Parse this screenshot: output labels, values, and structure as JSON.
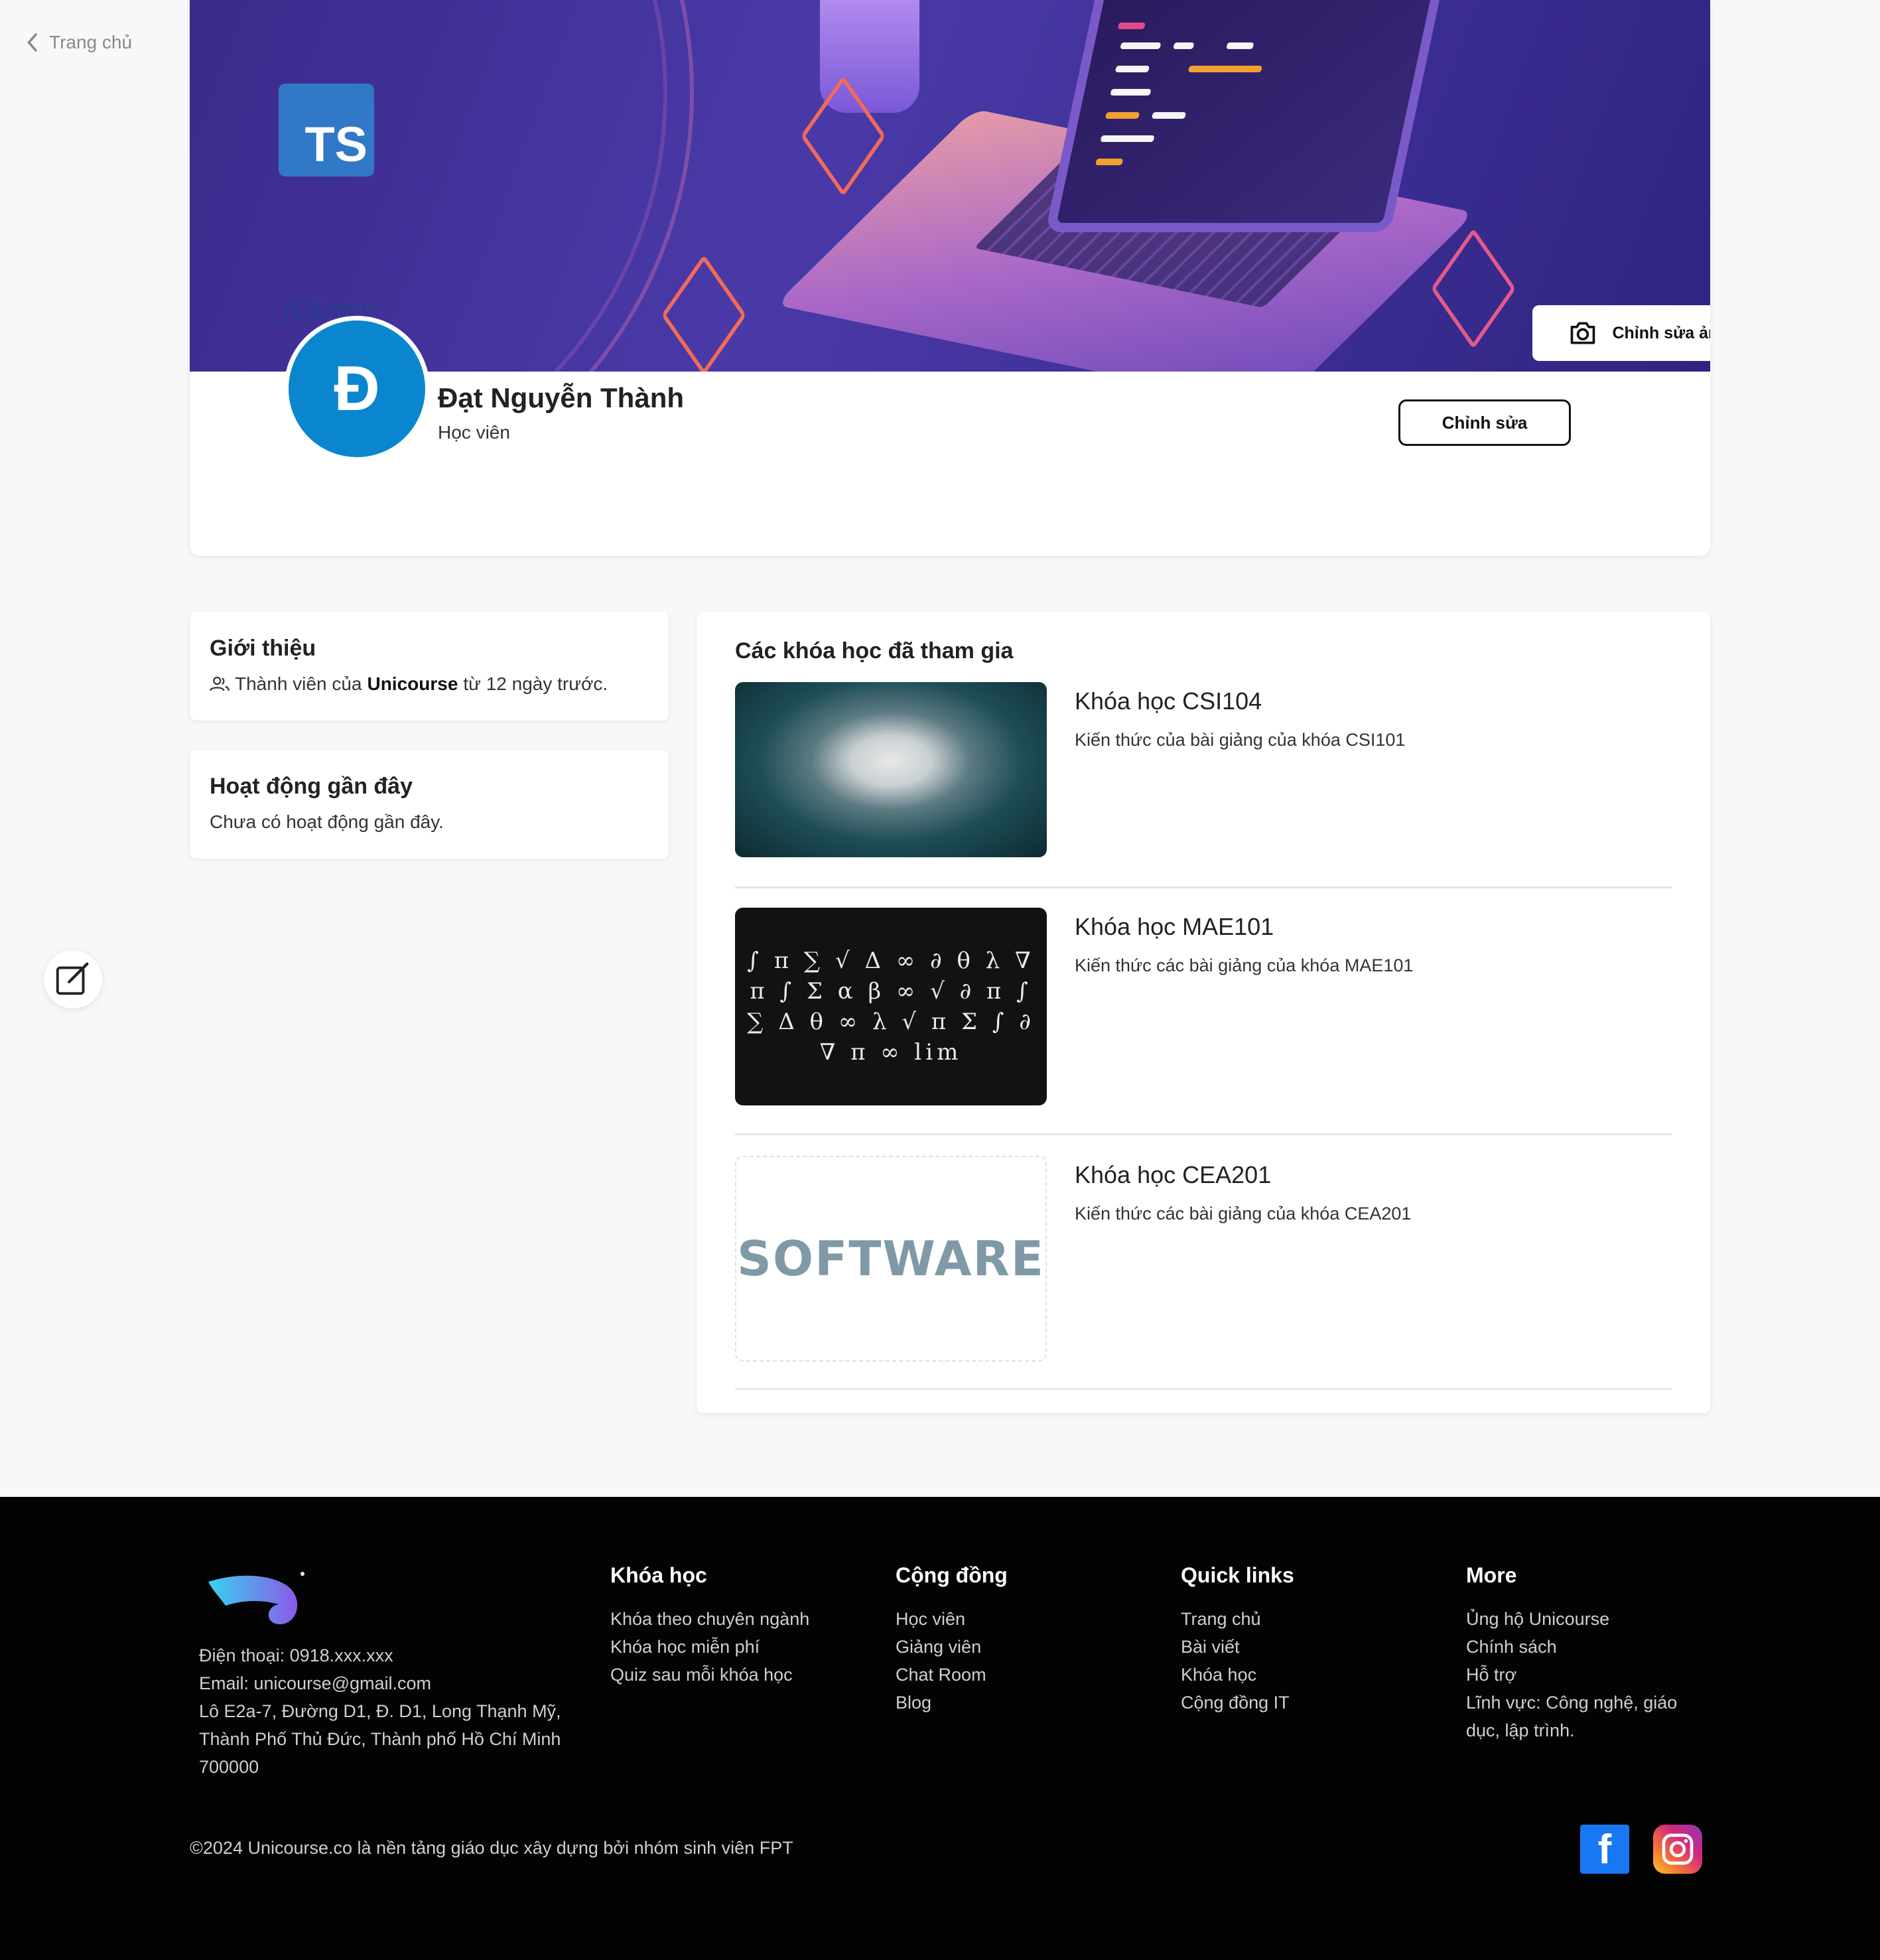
{
  "nav": {
    "back_label": "Trang chủ"
  },
  "profile": {
    "cover_edit_label": "Chỉnh sửa ảnh",
    "avatar_letter": "Đ",
    "name": "Đạt Nguyễn Thành",
    "role": "Học viên",
    "edit_label": "Chỉnh sửa"
  },
  "intro": {
    "title": "Giới thiệu",
    "text_before": "Thành viên của",
    "brand": "Unicourse",
    "text_after": "từ 12 ngày trước."
  },
  "activity": {
    "title": "Hoạt động gần đây",
    "text": "Chưa có hoạt động gần đây."
  },
  "courses": {
    "title": "Các khóa học đã tham gia",
    "items": [
      {
        "name": "Khóa học CSI104",
        "desc": "Kiến thức của bài giảng của khóa CSI101"
      },
      {
        "name": "Khóa học MAE101",
        "desc": "Kiến thức các bài giảng của khóa MAE101"
      },
      {
        "name": "Khóa học CEA201",
        "desc": "Kiến thức các bài giảng của khóa CEA201",
        "image_text": "SOFTWARE"
      }
    ]
  },
  "footer": {
    "phone": "Điện thoại: 0918.xxx.xxx",
    "email": "Email: unicourse@gmail.com",
    "address": "Lô E2a-7, Đường D1, Đ. D1, Long Thạnh Mỹ, Thành Phố Thủ Đức, Thành phố Hồ Chí Minh 700000",
    "columns": [
      {
        "title": "Khóa học",
        "links": [
          "Khóa theo chuyên ngành",
          "Khóa học miễn phí",
          "Quiz sau mỗi khóa học"
        ]
      },
      {
        "title": "Cộng đồng",
        "links": [
          "Học viên",
          "Giảng viên",
          "Chat Room",
          "Blog"
        ]
      },
      {
        "title": "Quick links",
        "links": [
          "Trang chủ",
          "Bài viết",
          "Khóa học",
          "Cộng đồng IT"
        ]
      },
      {
        "title": "More",
        "links": [
          "Ủng hộ Unicourse",
          "Chính sách",
          "Hỗ trợ",
          "Lĩnh vực: Công nghệ, giáo dục, lập trình."
        ]
      }
    ],
    "copyright": "©2024 Unicourse.co là nền tảng giáo dục xây dựng bởi nhóm sinh viên FPT"
  },
  "colors": {
    "avatar_bg": "#0a86cf",
    "footer_bg": "#030303",
    "cover_bg": "#3d2f96"
  },
  "icons": [
    "chevron-left-icon",
    "camera-icon",
    "users-icon",
    "edit-note-icon",
    "facebook-icon",
    "instagram-icon"
  ]
}
